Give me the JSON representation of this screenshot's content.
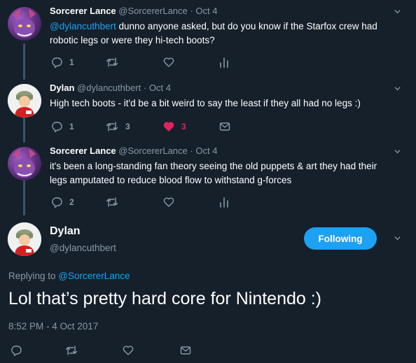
{
  "tweets": [
    {
      "name": "Sorcerer Lance",
      "handle": "@SorcererLance",
      "sep": "·",
      "date": "Oct 4",
      "mention": "@dylancuthbert",
      "text_line1": " dunno anyone asked, but do you know if the Starfox crew had",
      "text_line2": "robotic legs or were they hi-tech boots?",
      "reply_count": "1",
      "retweet_count": "",
      "like_count": ""
    },
    {
      "name": "Dylan",
      "handle": "@dylancuthbert",
      "sep": "·",
      "date": "Oct 4",
      "text_line1": "High tech boots - it'd be a bit weird to say the least if they all had no legs :)",
      "reply_count": "1",
      "retweet_count": "3",
      "like_count": "3"
    },
    {
      "name": "Sorcerer Lance",
      "handle": "@SorcererLance",
      "sep": "·",
      "date": "Oct 4",
      "text_line1": "it's been a long-standing fan theory seeing the old puppets & art they had their",
      "text_line2": "legs amputated to reduce blood flow to withstand g-forces",
      "reply_count": "2",
      "retweet_count": "",
      "like_count": ""
    }
  ],
  "main": {
    "name": "Dylan",
    "handle": "@dylancuthbert",
    "follow_label": "Following",
    "replying_prefix": "Replying to ",
    "replying_to": "@SorcererLance",
    "text": "Lol that’s pretty hard core for Nintendo :)",
    "timestamp": "8:52 PM - 4 Oct 2017"
  },
  "colors": {
    "background": "#15202b",
    "accent": "#1da1f2",
    "like": "#e0245e",
    "muted": "#8899a6"
  },
  "icons": {
    "reply": "reply-icon",
    "retweet": "retweet-icon",
    "like": "heart-icon",
    "analytics": "analytics-icon",
    "dm": "envelope-icon",
    "more": "chevron-down-icon"
  }
}
